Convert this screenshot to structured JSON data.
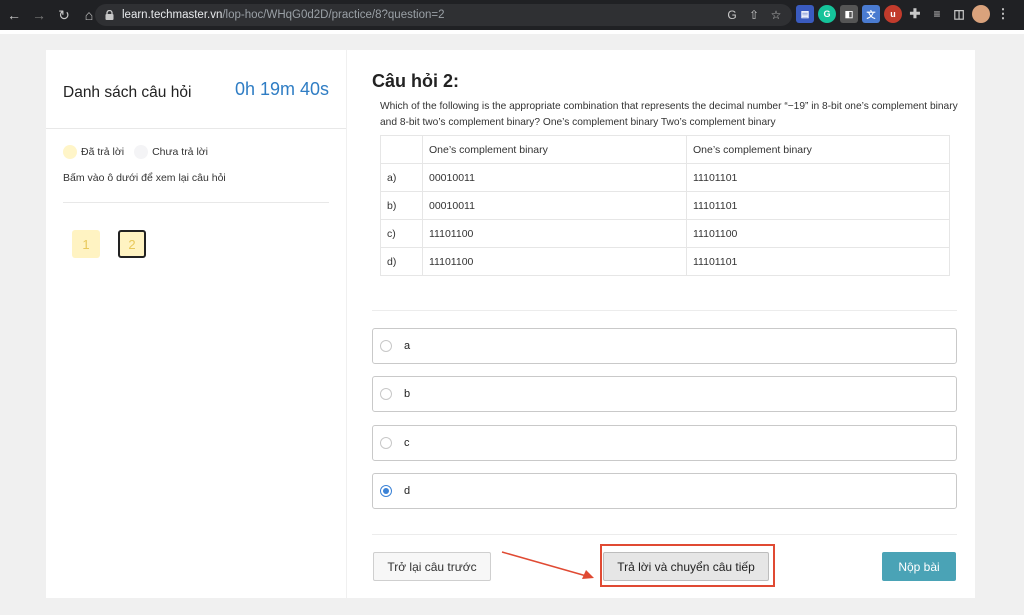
{
  "browser": {
    "url_host": "learn.techmaster.vn",
    "url_path": "/lop-hoc/WHqG0d2D/practice/8?question=2"
  },
  "sidebar": {
    "title": "Danh sách câu hỏi",
    "timer": "0h 19m 40s",
    "legend_answered": "Đã trả lời",
    "legend_unanswered": "Chưa trả lời",
    "hint": "Bấm vào ô dưới để xem lại câu hỏi",
    "questions": [
      "1",
      "2"
    ]
  },
  "question": {
    "title": "Câu hỏi 2:",
    "text": "Which of the following is the appropriate combination that represents the decimal number “−19” in 8-bit one’s complement binary and 8-bit two’s complement binary? One’s complement binary Two’s complement binary",
    "table": {
      "headers": [
        "",
        "One’s complement binary",
        "One’s complement binary"
      ],
      "rows": [
        [
          "a)",
          "00010011",
          "11101101"
        ],
        [
          "b)",
          "00010011",
          "11101101"
        ],
        [
          "c)",
          "11101100",
          "11101100"
        ],
        [
          "d)",
          "11101100",
          "11101101"
        ]
      ]
    },
    "options": [
      {
        "label": "a",
        "selected": false
      },
      {
        "label": "b",
        "selected": false
      },
      {
        "label": "c",
        "selected": false
      },
      {
        "label": "d",
        "selected": true
      }
    ]
  },
  "buttons": {
    "prev": "Trở lại câu trước",
    "next": "Trả lời và chuyển câu tiếp",
    "submit": "Nộp bài"
  },
  "colors": {
    "timer": "#2f7dc4",
    "submit": "#4aa3b6",
    "highlight": "#e04a33",
    "answered": "#fff3c2"
  }
}
